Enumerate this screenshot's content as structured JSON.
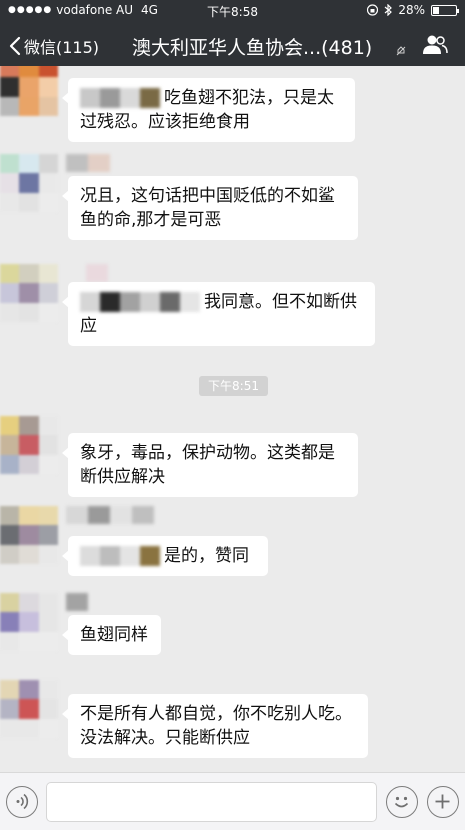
{
  "status_bar": {
    "signal": "●●●●●",
    "carrier": "vodafone AU",
    "network": "4G",
    "time": "下午8:58",
    "battery": "28%",
    "battery_level": 0.28
  },
  "nav": {
    "back_label": "微信(115)",
    "title": "澳大利亚华人鱼协会...",
    "member_count": "(481)"
  },
  "divider_time": "下午8:51",
  "messages": [
    {
      "text": "吃鱼翅不犯法，只是太过残忍。应该拒绝食用"
    },
    {
      "text": "况且，这句话把中国贬低的不如鲨鱼的命,那才是可恶"
    },
    {
      "text": "我同意。但不如断供应"
    },
    {
      "text": "象牙，毒品，保护动物。这类都是断供应解决"
    },
    {
      "text": "是的，赞同"
    },
    {
      "text": "鱼翅同样"
    },
    {
      "text": "不是所有人都自觉，你不吃别人吃。没法解决。只能断供应"
    }
  ],
  "colors": {
    "header_bg": "#2f3236",
    "chat_bg": "#ebebeb",
    "bubble_bg": "#ffffff",
    "time_chip_bg": "#d2d2d2",
    "input_bar_bg": "#f4f4f6"
  },
  "icons": {
    "back": "chevron-left-icon",
    "mute": "mute-icon",
    "members": "group-members-icon",
    "voice": "voice-icon",
    "emoji": "emoji-icon",
    "plus": "plus-icon",
    "lock": "rotation-lock-icon"
  }
}
